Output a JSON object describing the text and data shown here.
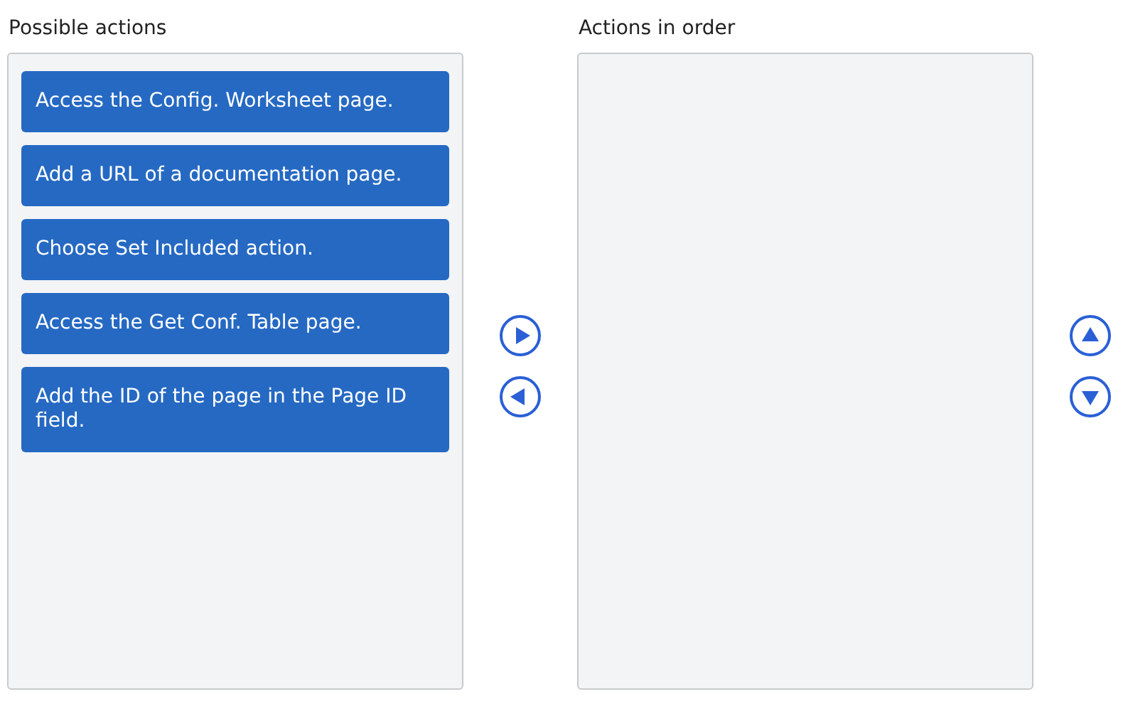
{
  "possible_actions": {
    "title": "Possible actions",
    "items": [
      {
        "label": "Access the Config. Worksheet page."
      },
      {
        "label": "Add a URL of a documentation page."
      },
      {
        "label": "Choose Set Included action."
      },
      {
        "label": "Access the Get Conf. Table page."
      },
      {
        "label": "Add the ID of the page in the Page ID field."
      }
    ]
  },
  "transfer_buttons": [
    {
      "kind": "right"
    },
    {
      "kind": "left"
    }
  ],
  "actions_in_order": {
    "title": "Actions in order"
  },
  "order_buttons": [
    {
      "kind": "up"
    },
    {
      "kind": "down"
    }
  ]
}
